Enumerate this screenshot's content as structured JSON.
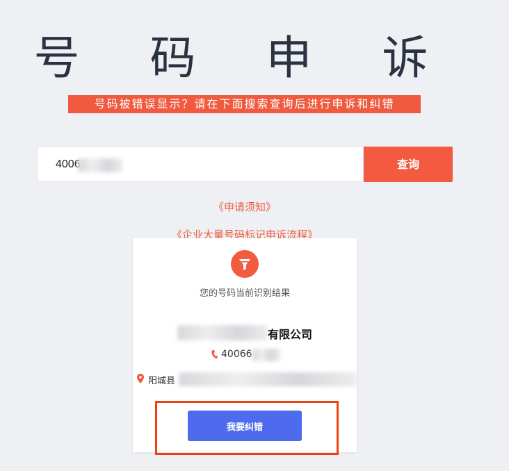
{
  "header": {
    "title": "号 码 申 诉",
    "subtitle": "号码被错误显示？请在下面搜索查询后进行申诉和纠错"
  },
  "search": {
    "value": "4006",
    "button_label": "查询"
  },
  "links": {
    "notice": "《申请须知》",
    "process": "《企业大量号码标记申诉流程》"
  },
  "result": {
    "caption": "您的号码当前识别结果",
    "company_suffix": "有限公司",
    "phone_prefix": "40066",
    "address_prefix": "阳城县",
    "correct_button": "我要纠错"
  },
  "colors": {
    "accent": "#f25b3f",
    "primary_button": "#4e6bef",
    "highlight": "#f0400f"
  },
  "icons": {
    "card": "filter-icon",
    "phone": "phone-icon",
    "address": "location-pin-icon"
  }
}
